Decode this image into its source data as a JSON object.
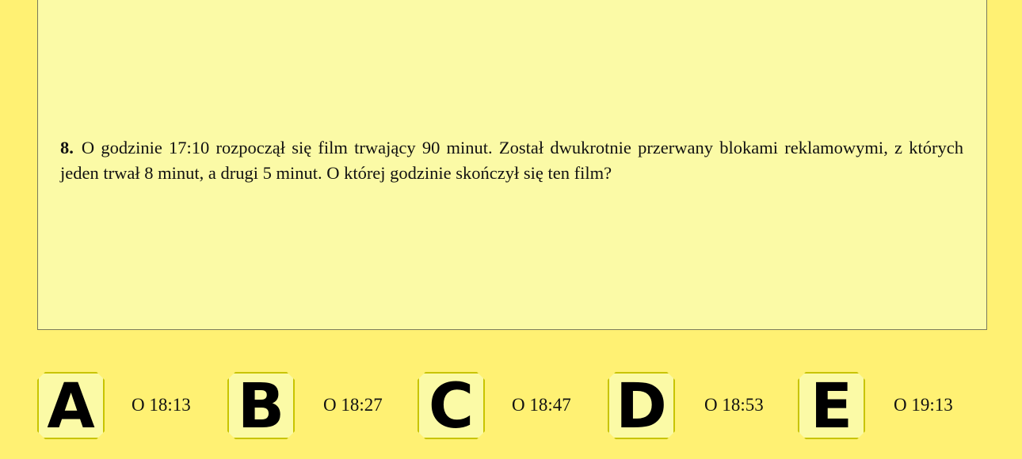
{
  "question": {
    "number": "8.",
    "text": "O godzinie 17:10 rozpoczął się film trwający 90 minut. Został dwukrotnie przerwany blokami reklamowymi, z których jeden trwał 8 minut, a drugi 5 minut. O której godzinie skończył się ten film?"
  },
  "answers": [
    {
      "letter": "A",
      "value": "O 18:13"
    },
    {
      "letter": "B",
      "value": "O 18:27"
    },
    {
      "letter": "C",
      "value": "O 18:47"
    },
    {
      "letter": "D",
      "value": "O 18:53"
    },
    {
      "letter": "E",
      "value": "O 19:13"
    }
  ],
  "colors": {
    "page_background": "#fff173",
    "panel_background": "#fbfaa6",
    "key_border": "#c8c400"
  }
}
